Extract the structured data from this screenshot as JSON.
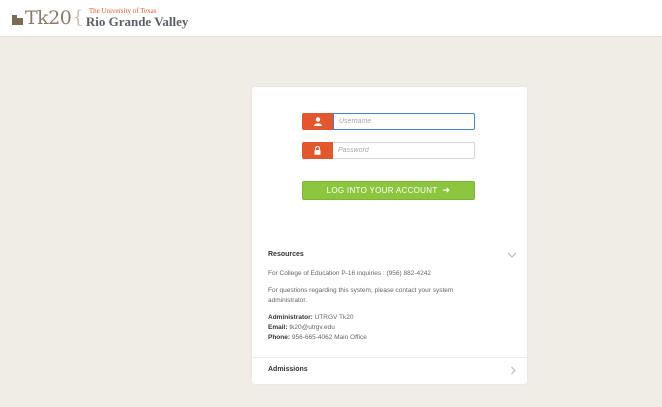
{
  "header": {
    "logo_tk": "Tk20",
    "logo_univ_line1": "The University of Texas",
    "logo_univ_line2": "Rio Grande Valley"
  },
  "login": {
    "username_placeholder": "Username",
    "password_placeholder": "Password",
    "username_icon": "user-icon",
    "password_icon": "lock-icon",
    "button_label": "LOG INTO YOUR ACCOUNT",
    "button_icon": "arrow-right-icon",
    "accent_color": "#e2572e",
    "button_color": "#8cc63f"
  },
  "resources": {
    "title": "Resources",
    "line1": "For College of Education P-16 inquiries : (956) 882-4242",
    "line2a": "For questions regarding this system, please contact your system",
    "line2b": "administrator.",
    "admin_label": "Administrator:",
    "admin_value": "UTRGV Tk20",
    "email_label": "Email:",
    "email_value": "tk20@utrgv.edu",
    "phone_label": "Phone:",
    "phone_value": "956-665-4062 Main Office"
  },
  "admissions": {
    "title": "Admissions"
  }
}
